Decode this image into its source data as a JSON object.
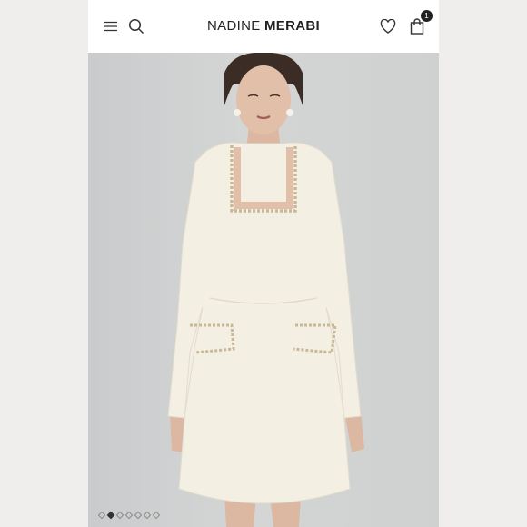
{
  "header": {
    "brand_first": "NADINE",
    "brand_last": "MERABI",
    "cart_count": "1",
    "icons": [
      "menu-icon",
      "search-icon",
      "heart-icon",
      "shopping-bag-icon"
    ]
  },
  "gallery": {
    "image_count": 7,
    "active_index": 1
  },
  "colors": {
    "background": "#efeeec",
    "header": "#ffffff",
    "text": "#222222",
    "dress": "#f4efe3"
  }
}
